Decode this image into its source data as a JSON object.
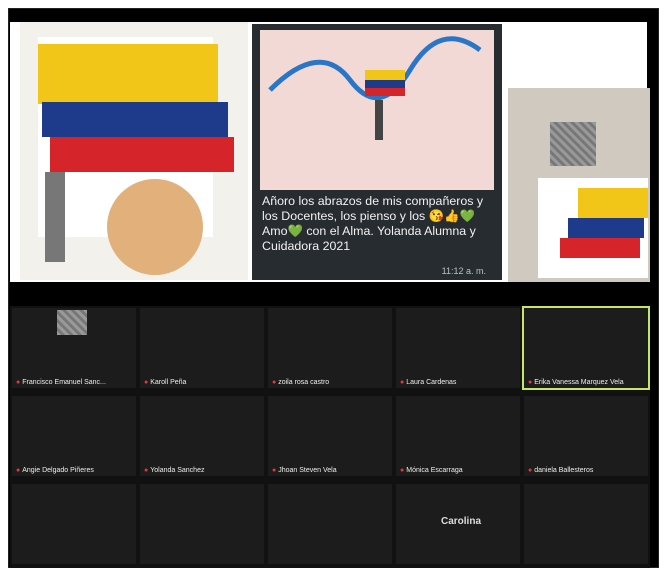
{
  "chat": {
    "message": "Añoro los abrazos de mis compañeros y los Docentes, los pienso y los 😘👍💚 Amo💚 con el Alma. Yolanda Alumna y Cuidadora 2021",
    "time": "11:12 a. m."
  },
  "participants": [
    {
      "name": "Francisco Emanuel Sanc..."
    },
    {
      "name": "Karoll Peña"
    },
    {
      "name": "zoila rosa castro"
    },
    {
      "name": "Laura Cardenas"
    },
    {
      "name": "Erika Vanessa Marquez Vela",
      "active": true
    },
    {
      "name": "Angie Delgado Piñeres"
    },
    {
      "name": "Yolanda Sanchez"
    },
    {
      "name": "Jhoan Steven Vela"
    },
    {
      "name": "Mónica Escarraga"
    },
    {
      "name": "daniela Ballesteros"
    },
    {
      "name": ""
    },
    {
      "name": ""
    },
    {
      "name": ""
    },
    {
      "name": "Carolina"
    }
  ]
}
